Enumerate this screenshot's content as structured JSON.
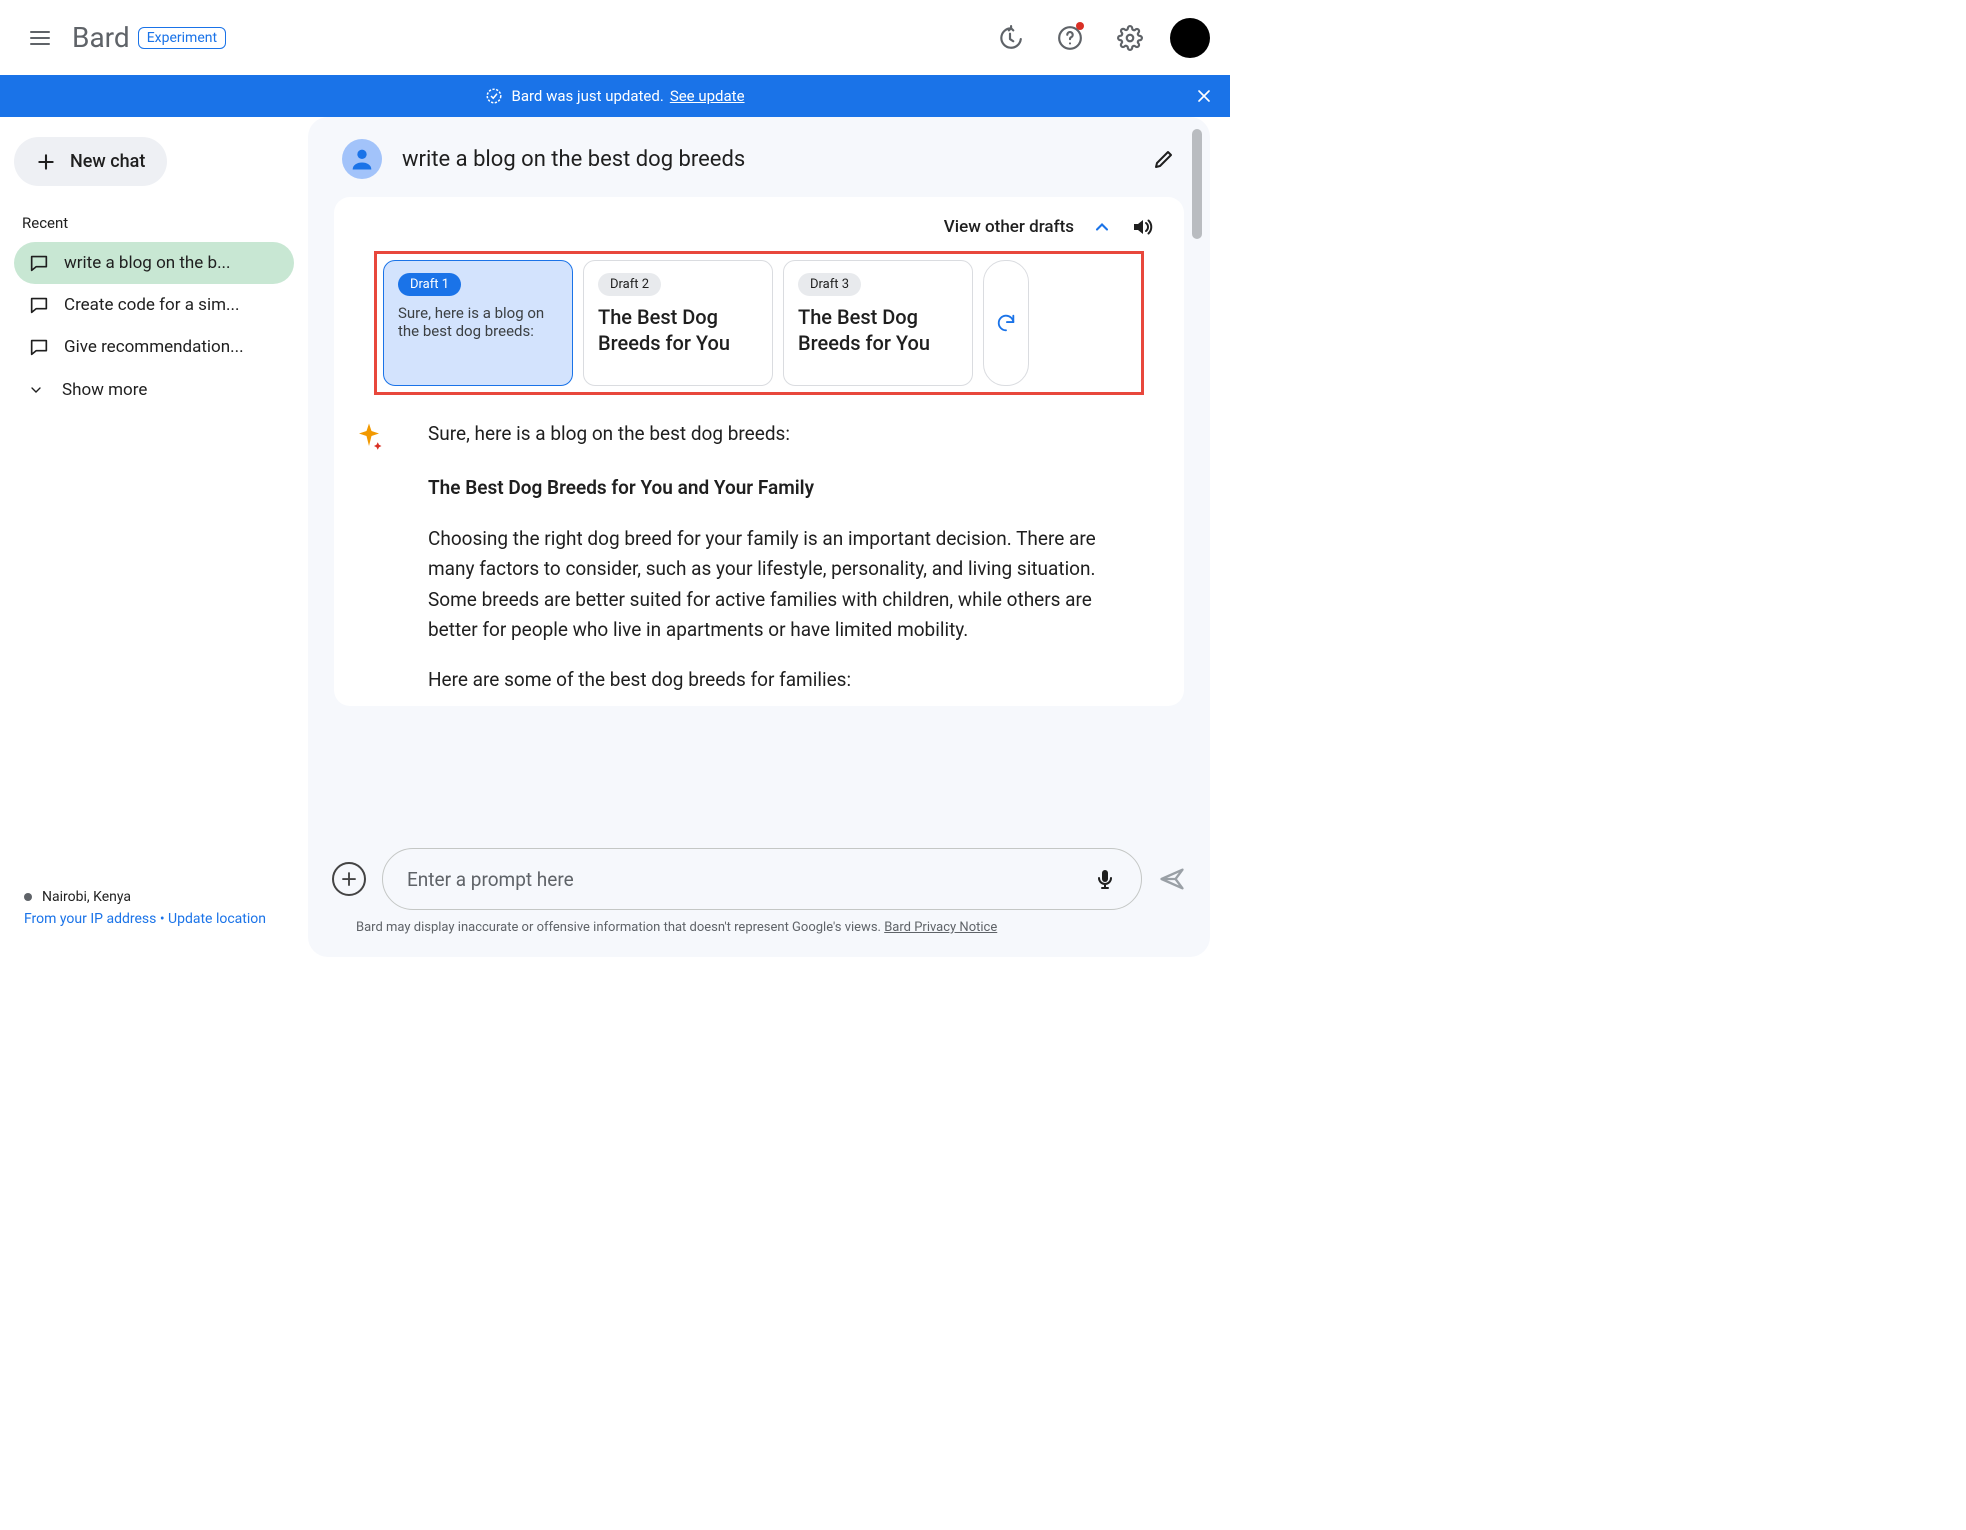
{
  "header": {
    "logo": "Bard",
    "badge": "Experiment"
  },
  "banner": {
    "text": "Bard was just updated.",
    "link": "See update"
  },
  "sidebar": {
    "new_chat": "New chat",
    "recent_label": "Recent",
    "items": [
      {
        "label": "write a blog on the b..."
      },
      {
        "label": "Create code for a sim..."
      },
      {
        "label": "Give recommendation..."
      }
    ],
    "show_more": "Show more",
    "location": "Nairobi, Kenya",
    "location_sub": "From your IP address",
    "update_loc": "Update location"
  },
  "chat": {
    "prompt": "write a blog on the best dog breeds",
    "view_drafts": "View other drafts",
    "drafts": [
      {
        "badge": "Draft 1",
        "preview": "Sure, here is a blog on the best dog breeds:"
      },
      {
        "badge": "Draft 2",
        "preview": "The Best Dog Breeds for You"
      },
      {
        "badge": "Draft 3",
        "preview": "The Best Dog Breeds for You"
      }
    ],
    "response_intro": "Sure, here is a blog on the best dog breeds:",
    "response_heading": "The Best Dog Breeds for You and Your Family",
    "response_p1": "Choosing the right dog breed for your family is an important decision. There are many factors to consider, such as your lifestyle, personality, and living situation. Some breeds are better suited for active families with children, while others are better for people who live in apartments or have limited mobility.",
    "response_p2": "Here are some of the best dog breeds for families:",
    "placeholder": "Enter a prompt here",
    "disclaimer": "Bard may display inaccurate or offensive information that doesn't represent Google's views.",
    "privacy": "Bard Privacy Notice"
  }
}
